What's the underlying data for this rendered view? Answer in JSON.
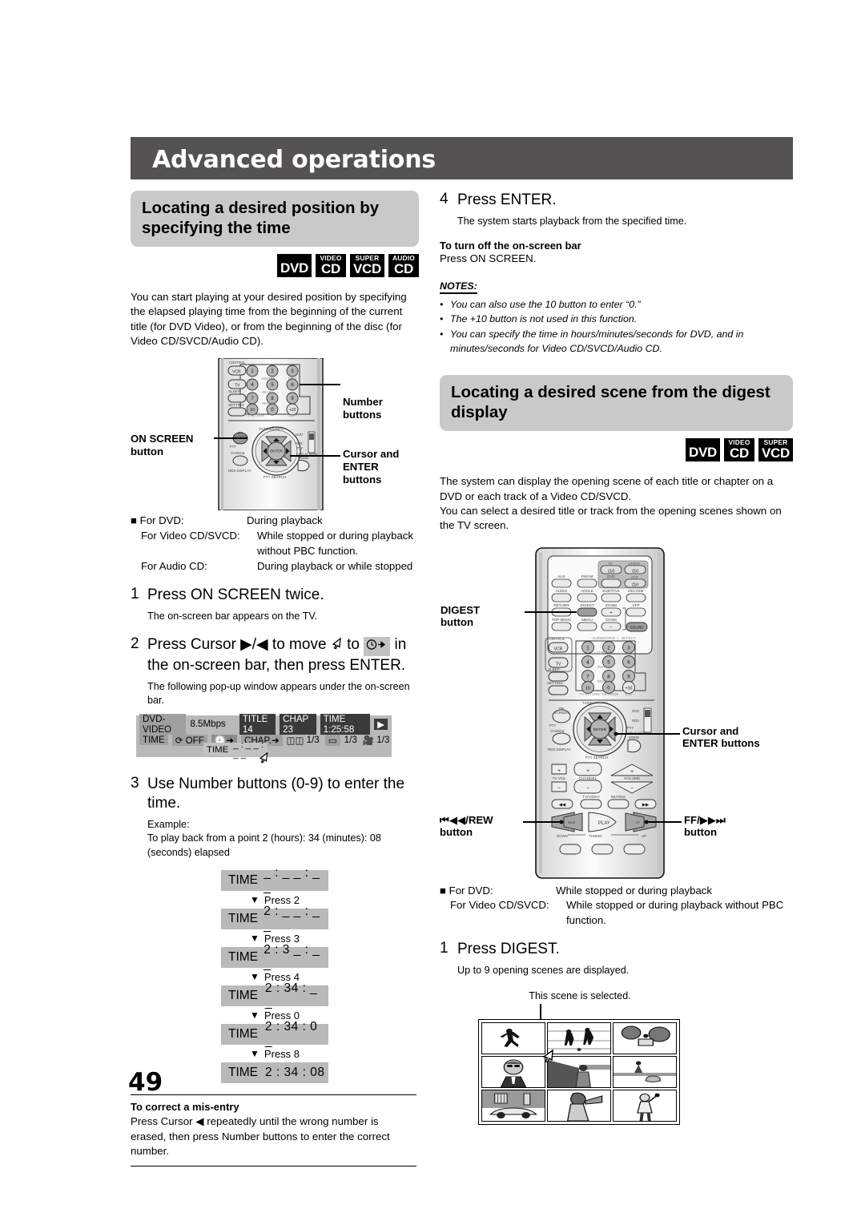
{
  "header": {
    "title": "Advanced operations"
  },
  "page_number": "49",
  "left": {
    "section_title": "Locating a desired position by specifying the time",
    "badges": [
      {
        "top": "",
        "main": "DVD"
      },
      {
        "top": "VIDEO",
        "main": "CD"
      },
      {
        "top": "SUPER",
        "main": "VCD"
      },
      {
        "top": "AUDIO",
        "main": "CD"
      }
    ],
    "intro": "You can start playing at your desired position by specifying the elapsed playing time from the beginning of the current title (for DVD Video), or from the beginning of the disc (for Video CD/SVCD/Audio CD).",
    "remote_callouts": {
      "number_buttons": "Number buttons",
      "on_screen_line1": "ON SCREEN",
      "on_screen_line2": "button",
      "cursor_line1": "Cursor and",
      "cursor_line2": "ENTER buttons"
    },
    "conditions": [
      {
        "label": "For DVD:",
        "value": "During playback"
      },
      {
        "label": "For Video CD/SVCD:",
        "value": "While stopped or during playback without PBC function."
      },
      {
        "label": "For Audio CD:",
        "value": "During playback or while stopped"
      }
    ],
    "steps": [
      {
        "num": "1",
        "head": "Press ON SCREEN twice.",
        "body": "The on-screen bar appears on the TV."
      },
      {
        "num": "2",
        "head_part1": "Press Cursor ",
        "head_cursor": "▶/◀",
        "head_part2": " to move ",
        "head_part3": " to ",
        "head_part4": " in the on-screen bar, then press ENTER.",
        "body": "The following pop-up window appears under the on-screen bar."
      },
      {
        "num": "3",
        "head": "Use Number buttons (0-9) to enter the time.",
        "example_label": "Example:",
        "example_text": "To play back from a point 2 (hours): 34 (minutes): 08 (seconds) elapsed"
      }
    ],
    "osd_bar": {
      "disc_type": "DVD-VIDEO",
      "bitrate": "8.5Mbps",
      "title": "TITLE 14",
      "chapter": "CHAP 23",
      "time": "TIME 1:25:58",
      "row2": {
        "time_label": "TIME",
        "repeat": "OFF",
        "chapter_label": "CHAP.",
        "audio": "1/3",
        "subtitle": "1/3",
        "angle": "1/3"
      },
      "popup_label": "TIME",
      "popup_value": "_ : _ _ : _ _"
    },
    "time_sequence": [
      {
        "label": "TIME",
        "value": "_ : _ _ : _ _",
        "press": "Press 2"
      },
      {
        "label": "TIME",
        "value": "2 : _ _ : _ _",
        "press": "Press 3"
      },
      {
        "label": "TIME",
        "value": "2 : 3 _ : _ _",
        "press": "Press 4"
      },
      {
        "label": "TIME",
        "value": "2 : 34 : _ _",
        "press": "Press 0"
      },
      {
        "label": "TIME",
        "value": "2 : 34 : 0 _",
        "press": "Press 8"
      },
      {
        "label": "TIME",
        "value": "2 : 34 : 08",
        "press": ""
      }
    ],
    "mis_entry": {
      "title": "To correct a mis-entry",
      "text_part1": "Press Cursor ",
      "text_part2": " repeatedly until the wrong number is erased, then press Number buttons to enter the correct number."
    }
  },
  "right": {
    "step4": {
      "num": "4",
      "head": "Press ENTER.",
      "body": "The system starts playback from the specified time."
    },
    "turn_off": {
      "title": "To turn off the on-screen bar",
      "text": "Press ON SCREEN."
    },
    "notes_heading": "NOTES:",
    "notes": [
      "You can also use the 10 button to enter “0.”",
      "The +10 button is not used in this function.",
      "You can specify the time in hours/minutes/seconds for DVD, and in minutes/seconds for Video CD/SVCD/Audio CD."
    ],
    "section_title": "Locating a desired scene from the digest display",
    "badges": [
      {
        "top": "",
        "main": "DVD"
      },
      {
        "top": "VIDEO",
        "main": "CD"
      },
      {
        "top": "SUPER",
        "main": "VCD"
      }
    ],
    "intro": "The system can display the opening scene of each title or chapter on a DVD or each track of a Video CD/SVCD.\nYou can select a desired title or track from the opening scenes shown on the TV screen.",
    "remote_callouts": {
      "digest_line1": "DIGEST",
      "digest_line2": "button",
      "cursor_line1": "Cursor and",
      "cursor_line2": "ENTER buttons",
      "rew_line1": "⏮◀◀/REW",
      "rew_line2": "button",
      "ff_line1": "FF/▶▶⏭",
      "ff_line2": "button"
    },
    "conditions": [
      {
        "label": "For DVD:",
        "value": "While stopped or during playback"
      },
      {
        "label": "For Video CD/SVCD:",
        "value": "While stopped or during playback without PBC function."
      }
    ],
    "step1": {
      "num": "1",
      "head": "Press DIGEST.",
      "body": "Up to 9 opening scenes are displayed."
    },
    "digest_caption": "This scene is selected."
  },
  "remote_keys": {
    "control": "CONTROL",
    "vcr": "VCR",
    "tv": "TV",
    "sleep": "SLEEP",
    "setting": "SETTING",
    "on_screen_l1": "ON",
    "on_screen_l2": "SCREEN",
    "choice": "CHOICE",
    "rds_display": "RDS DISPLAY",
    "enter": "ENTER",
    "pty": "PTY",
    "pty_search": "PTY SEARCH",
    "ta_news_info": "TA/NEWS/INFO",
    "mode": "MODE",
    "dvd": "DVD",
    "rds": "RDS",
    "numbers": [
      "1",
      "2",
      "3",
      "4",
      "5",
      "6",
      "7",
      "8",
      "9",
      "10",
      "0",
      "+10"
    ],
    "subwoofer": "SUBWOOFER",
    "center": "CENTER",
    "rear_l": "REAR-L",
    "rear_r": "REAR-R",
    "effect": "EFFECT",
    "test": "TEST",
    "tv_return": "TV RETURN",
    "fm_mode": "FM MODE",
    "hundred": "100+",
    "aux": "AUX",
    "fm_am": "FM/AM",
    "audio": "AUDIO",
    "angle": "ANGLE",
    "subtitle": "SUBTITLE",
    "decode": "DECODE",
    "return": "RETURN",
    "digest": "DIGEST",
    "zoom": "ZOOM",
    "vfp": "VFP",
    "top_menu": "TOP MENU",
    "menu": "MENU",
    "sound": "SOUND",
    "tv_label": "TV",
    "audio_label": "AUDIO",
    "vcr_label": "VCR",
    "tv_vol": "TV VOL",
    "channel": "CHANNEL",
    "volume": "VOLUME",
    "tv_video": "TV/VIDEO",
    "muting": "MUTING",
    "play": "PLAY",
    "rew": "REW",
    "ff": "FF",
    "down": "DOWN",
    "tuning": "TUNING",
    "up": "UP"
  }
}
